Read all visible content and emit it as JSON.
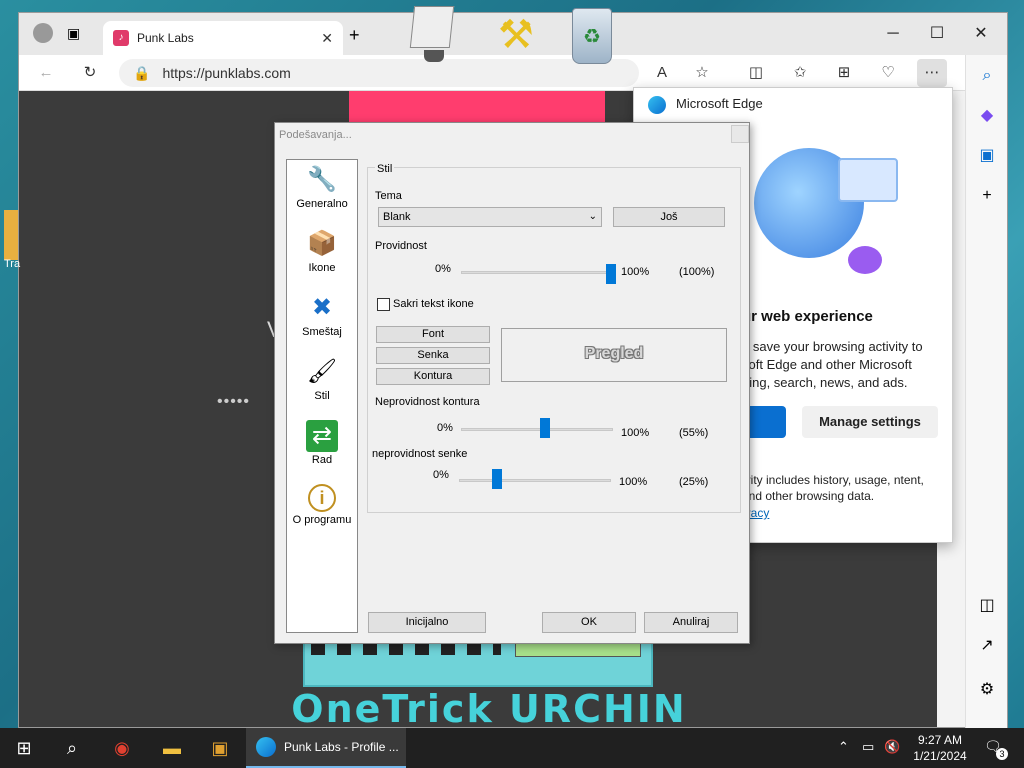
{
  "browser": {
    "tab_title": "Punk Labs",
    "url": "https://punklabs.com",
    "favicon": "punk-labs-icon"
  },
  "window_controls": {
    "minimize": "─",
    "maximize": "☐",
    "close": "✕"
  },
  "page": {
    "heading": "OneTrick URCHIN",
    "partial_letter": "V",
    "loading_dots": "•••••",
    "desktop_label_partial": "Tra"
  },
  "edge_popup": {
    "title": "Microsoft Edge",
    "heading": "ur web experience",
    "body": "o save your browsing activity to soft Edge and other Microsoft ping, search, news, and ads.",
    "footer": "ivity includes history, usage, ntent, and other browsing data.",
    "link": "ivacy",
    "manage_button": "Manage settings"
  },
  "dialog": {
    "title": "Podešavanja...",
    "nav": [
      {
        "label": "Generalno",
        "icon": "tools-icon"
      },
      {
        "label": "Ikone",
        "icon": "box-icon"
      },
      {
        "label": "Smeštaj",
        "icon": "arrows-icon"
      },
      {
        "label": "Stil",
        "icon": "brush-icon"
      },
      {
        "label": "Rad",
        "icon": "exchange-icon"
      },
      {
        "label": "O programu",
        "icon": "info-icon"
      }
    ],
    "section_title": "Stil",
    "theme_label": "Tema",
    "theme_value": "Blank",
    "more_button": "Još",
    "transparency_label": "Providnost",
    "transparency_min": "0%",
    "transparency_max": "100%",
    "transparency_value": "(100%)",
    "transparency_level": 100,
    "hide_text_label": "Sakri tekst ikone",
    "hide_text_checked": false,
    "font_button": "Font",
    "shadow_button": "Senka",
    "outline_button": "Kontura",
    "preview_label": "Pregled",
    "outline_opacity_label": "Neprovidnost kontura",
    "outline_min": "0%",
    "outline_max": "100%",
    "outline_value": "(55%)",
    "outline_level": 55,
    "shadow_opacity_label": "neprovidnost senke",
    "shadow_min": "0%",
    "shadow_max": "100%",
    "shadow_value": "(25%)",
    "shadow_level": 25,
    "default_button": "Inicijalno",
    "ok_button": "OK",
    "cancel_button": "Anuliraj"
  },
  "taskbar": {
    "active_app": "Punk Labs - Profile ...",
    "time": "9:27 AM",
    "date": "1/21/2024",
    "notification_count": "3"
  },
  "colors": {
    "accent": "#0078d7",
    "page_bg": "#3b3b3b",
    "heading": "#46d2da",
    "pink": "#ff3d6e"
  }
}
